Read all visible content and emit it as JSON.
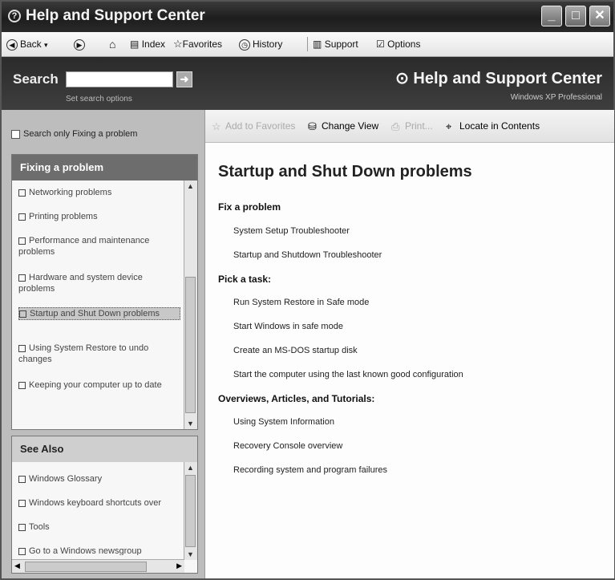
{
  "window": {
    "title": "Help and Support Center"
  },
  "toolbar": {
    "back": "Back",
    "index": "Index",
    "favorites": "Favorites",
    "history": "History",
    "support": "Support",
    "options": "Options"
  },
  "search": {
    "label": "Search",
    "placeholder": "",
    "set_options": "Set search options",
    "header_title": "Help and Support Center",
    "header_subtitle": "Windows XP Professional"
  },
  "left": {
    "search_only_label": "Search only Fixing a problem",
    "panel1": {
      "title": "Fixing a problem",
      "items": [
        "Networking problems",
        "Printing problems",
        "Performance and maintenance problems",
        "Hardware and system device problems",
        "Startup and Shut Down problems",
        "Using System Restore to undo changes",
        "Keeping your computer up to date"
      ]
    },
    "panel2": {
      "title": "See Also",
      "items": [
        "Windows Glossary",
        "Windows keyboard shortcuts over",
        "Tools",
        "Go to a Windows newsgroup"
      ]
    }
  },
  "right": {
    "toolbar": {
      "add_favorites": "Add to Favorites",
      "change_view": "Change View",
      "print": "Print...",
      "locate": "Locate in Contents"
    },
    "title": "Startup and Shut Down problems",
    "sections": [
      {
        "heading": "Fix a problem",
        "links": [
          "System Setup Troubleshooter",
          "Startup and Shutdown Troubleshooter"
        ]
      },
      {
        "heading": "Pick a task:",
        "links": [
          "Run System Restore in Safe mode",
          "Start Windows in safe mode",
          "Create an MS-DOS startup disk",
          "Start the computer using the last known good configuration"
        ]
      },
      {
        "heading": "Overviews, Articles, and Tutorials:",
        "links": [
          "Using System Information",
          "Recovery Console overview",
          "Recording system and program failures"
        ]
      }
    ]
  }
}
